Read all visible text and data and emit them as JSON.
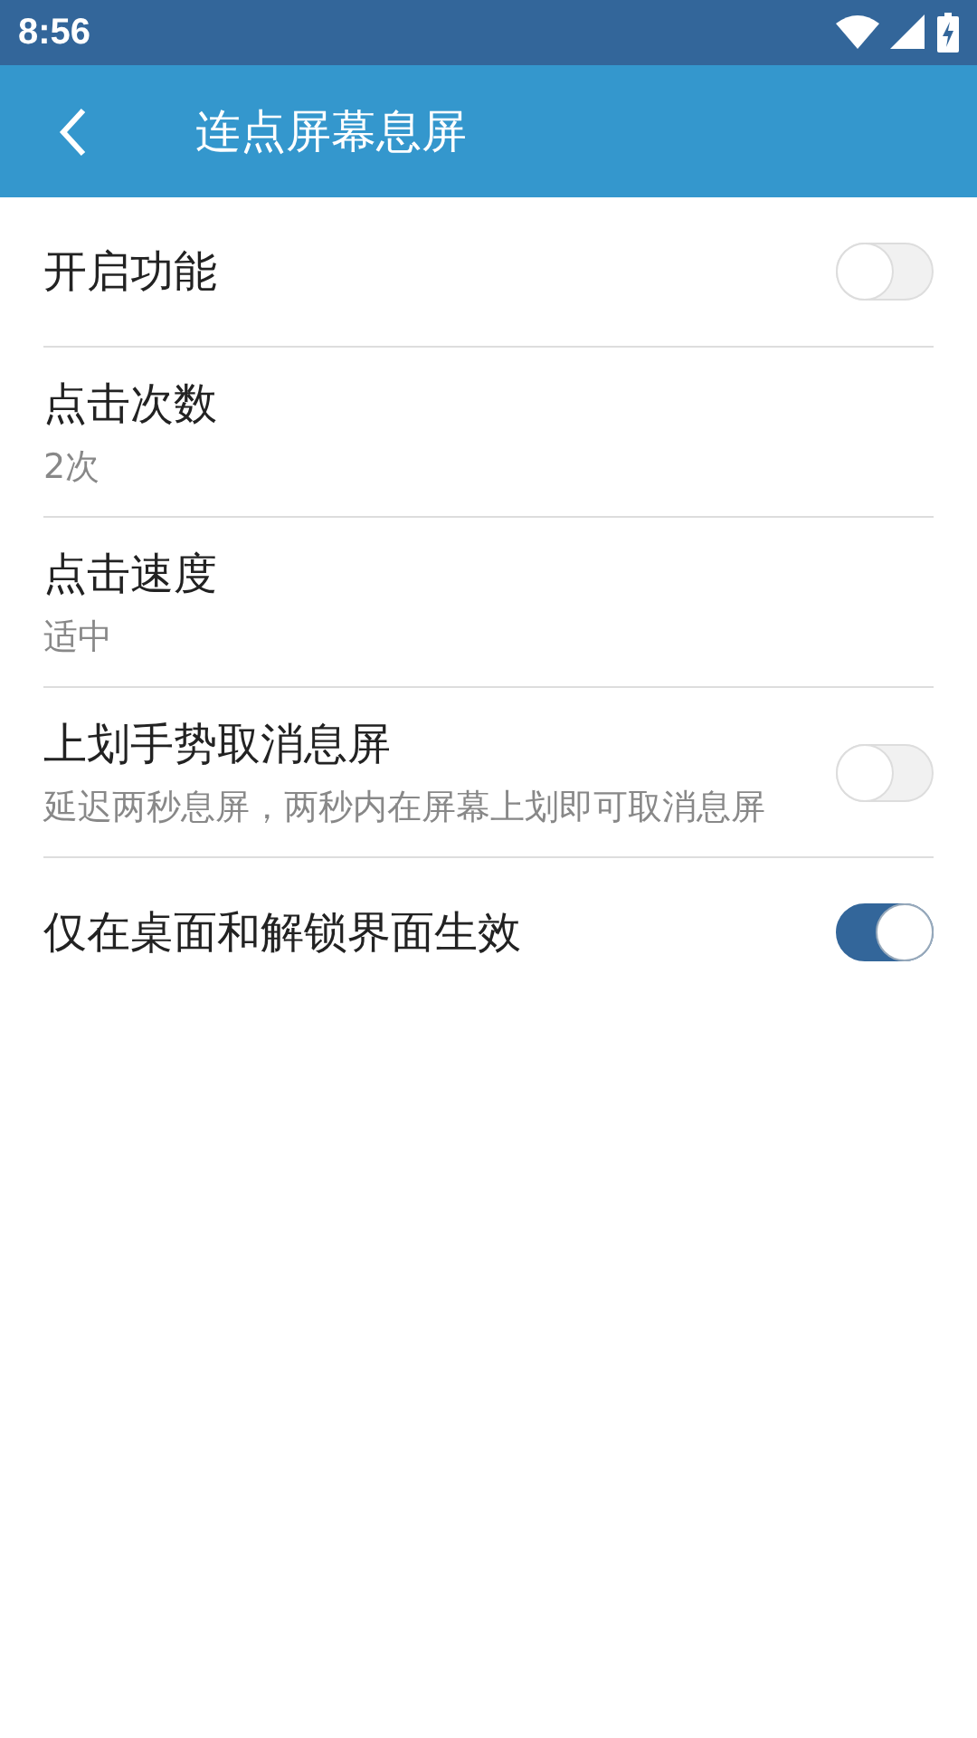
{
  "status_bar": {
    "time": "8:56"
  },
  "app_bar": {
    "title": "连点屏幕息屏"
  },
  "settings": [
    {
      "kind": "toggle",
      "title": "开启功能",
      "on": false
    },
    {
      "kind": "value",
      "title": "点击次数",
      "value": "2次"
    },
    {
      "kind": "value",
      "title": "点击速度",
      "value": "适中"
    },
    {
      "kind": "toggle",
      "title": "上划手势取消息屏",
      "subtitle": "延迟两秒息屏，两秒内在屏幕上划即可取消息屏",
      "on": false
    },
    {
      "kind": "toggle",
      "title": "仅在桌面和解锁界面生效",
      "on": true
    }
  ]
}
